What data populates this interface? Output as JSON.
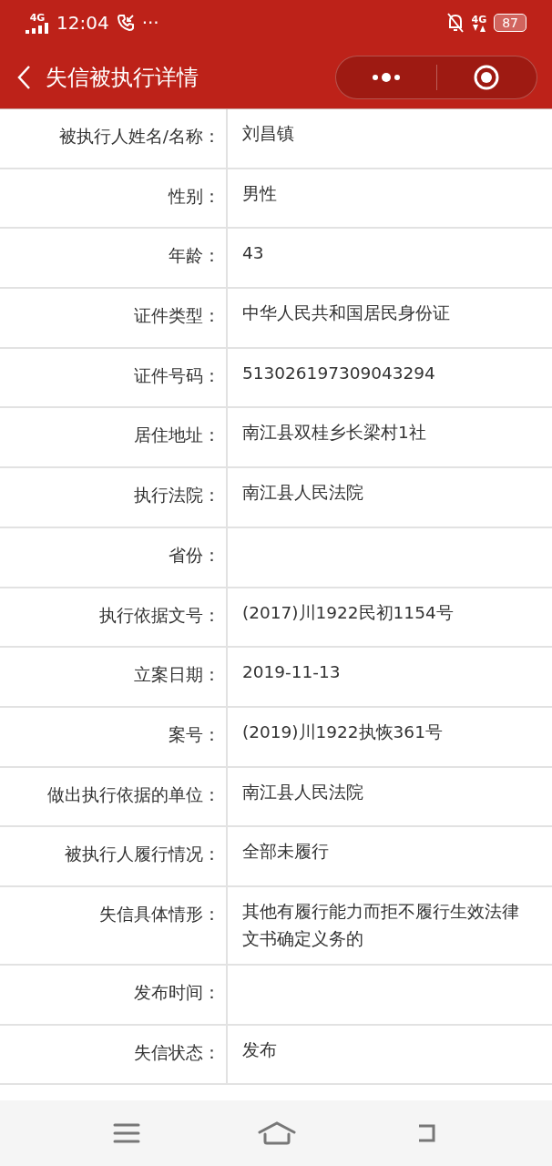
{
  "status_bar": {
    "network": "4G",
    "time": "12:04",
    "more": "···",
    "data_type": "4G",
    "battery": "87"
  },
  "header": {
    "title": "失信被执行详情"
  },
  "details": [
    {
      "label": "被执行人姓名/名称：",
      "value": "刘昌镇"
    },
    {
      "label": "性别：",
      "value": "男性"
    },
    {
      "label": "年龄：",
      "value": "43"
    },
    {
      "label": "证件类型：",
      "value": "中华人民共和国居民身份证"
    },
    {
      "label": "证件号码：",
      "value": "513026197309043294"
    },
    {
      "label": "居住地址：",
      "value": "南江县双桂乡长梁村1社"
    },
    {
      "label": "执行法院：",
      "value": "南江县人民法院"
    },
    {
      "label": "省份："
    },
    {
      "label": "执行依据文号：",
      "value": "(2017)川1922民初1154号"
    },
    {
      "label": "立案日期：",
      "value": "2019-11-13"
    },
    {
      "label": "案号：",
      "value": "(2019)川1922执恢361号"
    },
    {
      "label": "做出执行依据的单位：",
      "value": "南江县人民法院"
    },
    {
      "label": "被执行人履行情况：",
      "value": "全部未履行"
    },
    {
      "label": "失信具体情形：",
      "value": "其他有履行能力而拒不履行生效法律文书确定义务的"
    },
    {
      "label": "发布时间："
    },
    {
      "label": "失信状态：",
      "value": "发布"
    }
  ]
}
